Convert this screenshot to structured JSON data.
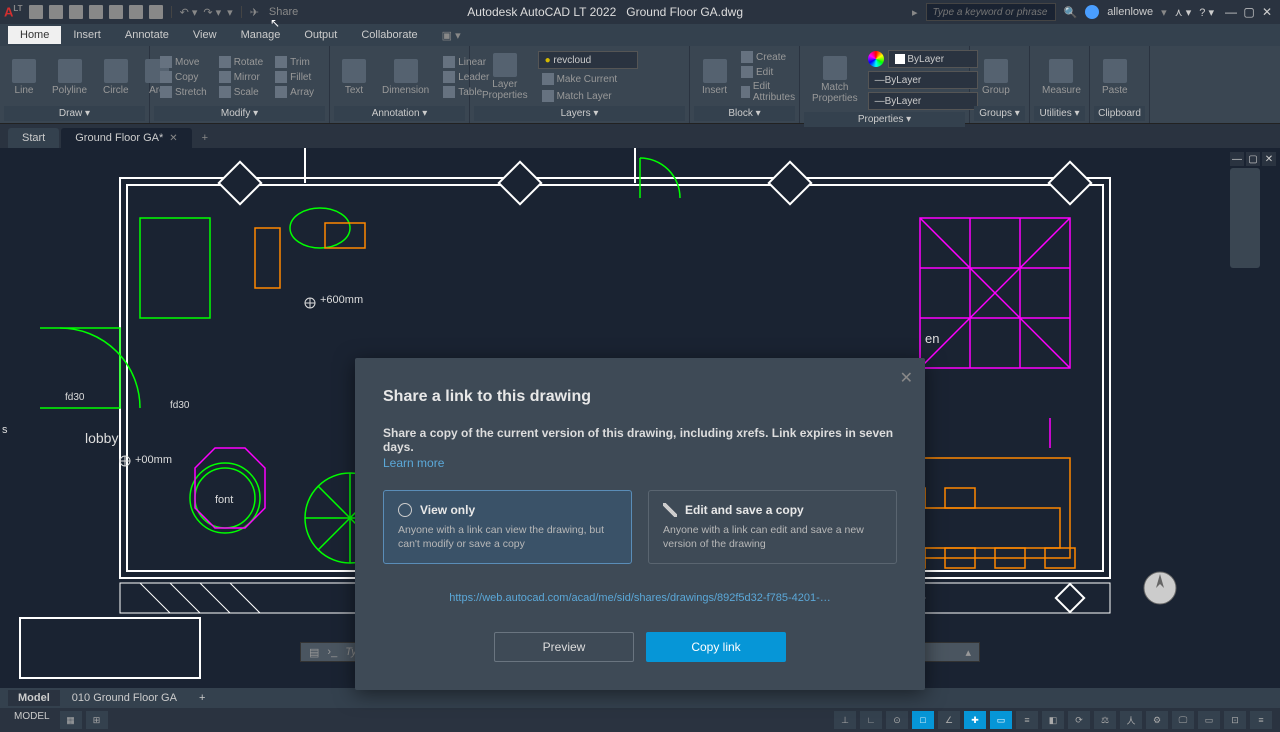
{
  "title": {
    "app": "Autodesk AutoCAD LT 2022",
    "doc": "Ground Floor  GA.dwg"
  },
  "qat": {
    "share_label": "Share"
  },
  "search": {
    "placeholder": "Type a keyword or phrase"
  },
  "user": {
    "name": "allenlowe"
  },
  "menubar": [
    "Home",
    "Insert",
    "Annotate",
    "View",
    "Manage",
    "Output",
    "Collaborate"
  ],
  "ribbon": {
    "draw": {
      "title": "Draw ▾",
      "items": [
        "Line",
        "Polyline",
        "Circle",
        "Arc"
      ]
    },
    "modify": {
      "title": "Modify ▾",
      "col1": [
        "Move",
        "Copy",
        "Stretch"
      ],
      "col2": [
        "Rotate",
        "Mirror",
        "Scale"
      ],
      "col3": [
        "Trim",
        "Fillet",
        "Array"
      ]
    },
    "annotation": {
      "title": "Annotation ▾",
      "big": [
        "Text",
        "Dimension"
      ],
      "col": [
        "Linear",
        "Leader",
        "Table"
      ]
    },
    "layers": {
      "title": "Layers ▾",
      "big": "Layer\nProperties",
      "current": "revcloud",
      "items": [
        "Make Current",
        "Match Layer"
      ]
    },
    "block": {
      "title": "Block ▾",
      "big": "Insert",
      "items": [
        "Create",
        "Edit",
        "Edit Attributes"
      ]
    },
    "properties": {
      "title": "Properties ▾",
      "big": "Match\nProperties",
      "layer": "ByLayer",
      "line1": "ByLayer",
      "line2": "ByLayer"
    },
    "groups": {
      "title": "Groups ▾",
      "big": "Group"
    },
    "utilities": {
      "title": "Utilities ▾",
      "big": "Measure"
    },
    "clipboard": {
      "title": "Clipboard",
      "big": "Paste"
    }
  },
  "file_tabs": {
    "start": "Start",
    "doc": "Ground Floor  GA*"
  },
  "drawing_labels": {
    "lobby": "lobby",
    "font": "font",
    "h600": "+600mm",
    "h0": "+00mm",
    "fd30a": "fd30",
    "fd30b": "fd30",
    "en": "en",
    "s": "s"
  },
  "dialog": {
    "title": "Share a link to this drawing",
    "description": "Share a copy of the current version of this drawing, including xrefs. Link expires in seven days.",
    "learn_more": "Learn more",
    "opt_view": {
      "title": "View only",
      "desc": "Anyone with a link can view the drawing, but can't modify or save a copy"
    },
    "opt_edit": {
      "title": "Edit and save a copy",
      "desc": "Anyone with a link can edit and save a new version of the drawing"
    },
    "url": "https://web.autocad.com/acad/me/sid/shares/drawings/892f5d32-f785-4201-…",
    "preview": "Preview",
    "copy": "Copy link"
  },
  "cmdline": {
    "placeholder": "Type a command"
  },
  "layout_tabs": {
    "model": "Model",
    "layout1": "010 Ground Floor GA"
  },
  "statusbar": {
    "model": "MODEL"
  }
}
